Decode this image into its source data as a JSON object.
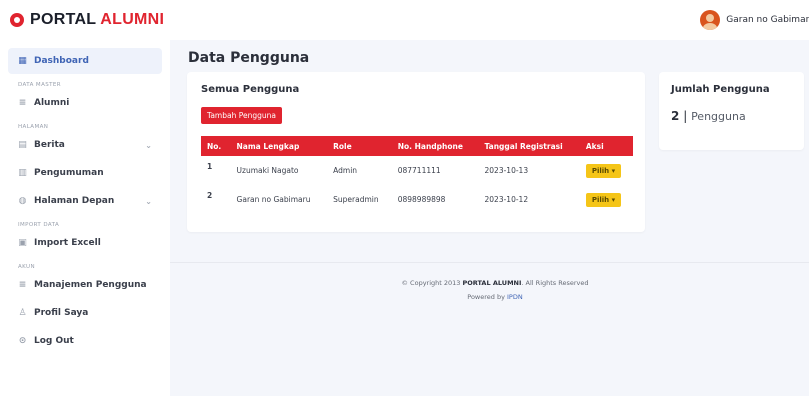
{
  "header": {
    "brand_prefix": "PORTAL",
    "brand_accent": "ALUMNI",
    "user_name": "Garan no Gabimaru"
  },
  "sidebar": {
    "items": [
      {
        "label": "Dashboard",
        "icon": "grid-icon",
        "active": true
      },
      {
        "section": "DATA MASTER"
      },
      {
        "label": "Alumni",
        "icon": "users-icon"
      },
      {
        "section": "HALAMAN"
      },
      {
        "label": "Berita",
        "icon": "newspaper-icon",
        "expandable": true
      },
      {
        "label": "Pengumuman",
        "icon": "megaphone-icon"
      },
      {
        "label": "Halaman Depan",
        "icon": "home-icon",
        "expandable": true
      },
      {
        "section": "IMPORT DATA"
      },
      {
        "label": "Import Excell",
        "icon": "file-icon"
      },
      {
        "section": "AKUN"
      },
      {
        "label": "Manajemen Pengguna",
        "icon": "users-gear-icon"
      },
      {
        "label": "Profil Saya",
        "icon": "person-icon"
      },
      {
        "label": "Log Out",
        "icon": "logout-icon"
      }
    ]
  },
  "main": {
    "page_title": "Data Pengguna",
    "users_card": {
      "title": "Semua Pengguna",
      "add_button": "Tambah Pengguna",
      "columns": [
        "No.",
        "Nama Lengkap",
        "Role",
        "No. Handphone",
        "Tanggal Registrasi",
        "Aksi"
      ],
      "rows": [
        {
          "no": "1",
          "name": "Uzumaki Nagato",
          "role": "Admin",
          "phone": "087711111",
          "date": "2023-10-13",
          "action": "Pilih"
        },
        {
          "no": "2",
          "name": "Garan no Gabimaru",
          "role": "Superadmin",
          "phone": "0898989898",
          "date": "2023-10-12",
          "action": "Pilih"
        }
      ]
    },
    "count_card": {
      "title": "Jumlah Pengguna",
      "count": "2",
      "separator": "|",
      "label": "Pengguna"
    }
  },
  "footer": {
    "copyright_prefix": "© Copyright 2013",
    "copyright_brand": "PORTAL ALUMNI",
    "copyright_suffix": ". All Rights Reserved",
    "powered_prefix": "Powered by",
    "powered_link": "IPDN"
  },
  "colors": {
    "accent_red": "#e0242f",
    "action_yellow": "#f5c518",
    "active_blue": "#3f64b5"
  }
}
